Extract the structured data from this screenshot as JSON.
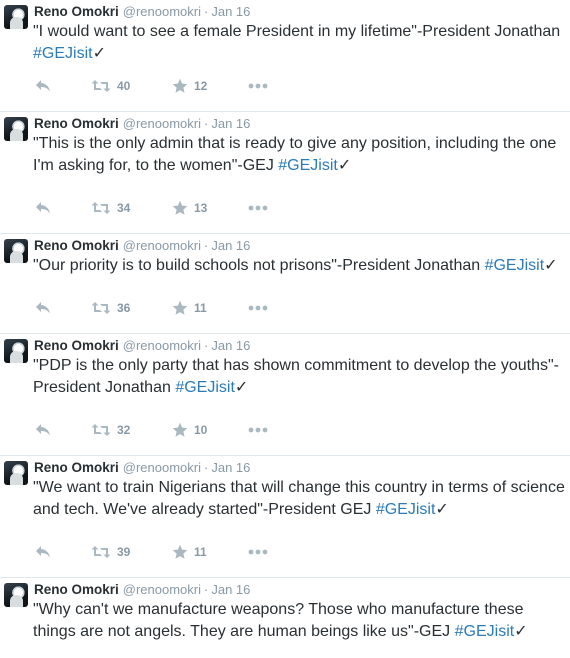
{
  "tweets": [
    {
      "name": "Reno Omokri",
      "handle": "@renoomokri",
      "separator": "·",
      "time": "Jan 16",
      "text_lines": [
        "\"I would want to see a female President in my lifetime\"-President Jonathan"
      ],
      "text_before_hashtag": "\"I would want to see a female President in my lifetime\"-President Jonathan ",
      "hashtag": "#GEJisit",
      "suffix": "✓",
      "retweets": "40",
      "favorites": "12"
    },
    {
      "name": "Reno Omokri",
      "handle": "@renoomokri",
      "separator": "·",
      "time": "Jan 16",
      "text_before_hashtag": "\"This is the only admin that is ready to give any position, including the one I'm asking for, to the women\"-GEJ ",
      "hashtag": "#GEJisit",
      "suffix": "✓",
      "retweets": "34",
      "favorites": "13"
    },
    {
      "name": "Reno Omokri",
      "handle": "@renoomokri",
      "separator": "·",
      "time": "Jan 16",
      "text_before_hashtag": "\"Our priority is to build schools not prisons\"-President Jonathan ",
      "hashtag": "#GEJisit",
      "suffix": "✓",
      "retweets": "36",
      "favorites": "11"
    },
    {
      "name": "Reno Omokri",
      "handle": "@renoomokri",
      "separator": "·",
      "time": "Jan 16",
      "text_before_hashtag": "\"PDP is the only party that has shown commitment to develop the youths\"-President Jonathan ",
      "hashtag": "#GEJisit",
      "suffix": "✓",
      "retweets": "32",
      "favorites": "10"
    },
    {
      "name": "Reno Omokri",
      "handle": "@renoomokri",
      "separator": "·",
      "time": "Jan 16",
      "text_before_hashtag": "\"We want to train Nigerians that will change this country in terms of science and tech. We've already started\"-President GEJ ",
      "hashtag": "#GEJisit",
      "suffix": "✓",
      "retweets": "39",
      "favorites": "11"
    },
    {
      "name": "Reno Omokri",
      "handle": "@renoomokri",
      "separator": "·",
      "time": "Jan 16",
      "text_before_hashtag": "\"Why can't we manufacture weapons? Those who manufacture these things are not angels. They are human beings like us\"-GEJ ",
      "hashtag": "#GEJisit",
      "suffix": "✓",
      "retweets": "",
      "favorites": ""
    }
  ],
  "icons": {
    "reply": "reply-icon",
    "retweet": "retweet-icon",
    "favorite": "star-icon",
    "more": "more-icon"
  },
  "colors": {
    "hashtag": "#2b7bb9",
    "meta": "#8899a6",
    "icon": "#aab8c2",
    "divider": "#e1e8ed"
  }
}
